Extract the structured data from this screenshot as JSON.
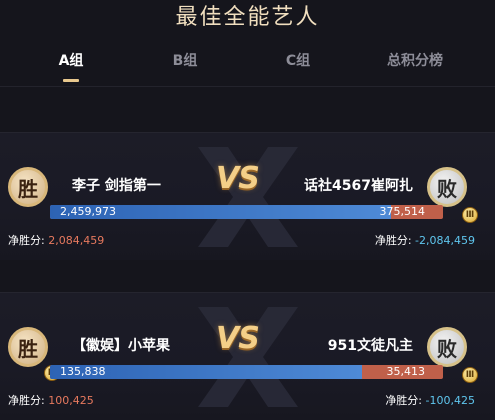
{
  "title": "最佳全能艺人",
  "tabs": [
    {
      "label": "A组",
      "active": true
    },
    {
      "label": "B组",
      "active": false
    },
    {
      "label": "C组",
      "active": false
    },
    {
      "label": "总积分榜",
      "active": false
    }
  ],
  "matches": [
    {
      "left": {
        "badge": "胜",
        "name": "李子 剑指第一",
        "votes": "2,459,973",
        "net_label": "净胜分:",
        "net_value": "2,084,459"
      },
      "right": {
        "badge": "败",
        "name": "话社4567崔阿扎",
        "votes": "375,514",
        "net_label": "净胜分:",
        "net_value": "-2,084,459"
      },
      "vs_label": "VS",
      "left_share": 0.8676
    },
    {
      "left": {
        "badge": "胜",
        "name": "【徽娱】小苹果",
        "votes": "135,838",
        "net_label": "净胜分:",
        "net_value": "100,425"
      },
      "right": {
        "badge": "败",
        "name": "951文徒凡主",
        "votes": "35,413",
        "net_label": "净胜分:",
        "net_value": "-100,425"
      },
      "vs_label": "VS",
      "left_share": 0.7932
    }
  ],
  "colors": {
    "accent_gold": "#e8c88e",
    "bar_blue": "#3d78c8",
    "bar_red": "#c0604a",
    "positive": "#e7795e",
    "negative": "#5fc6ee"
  }
}
